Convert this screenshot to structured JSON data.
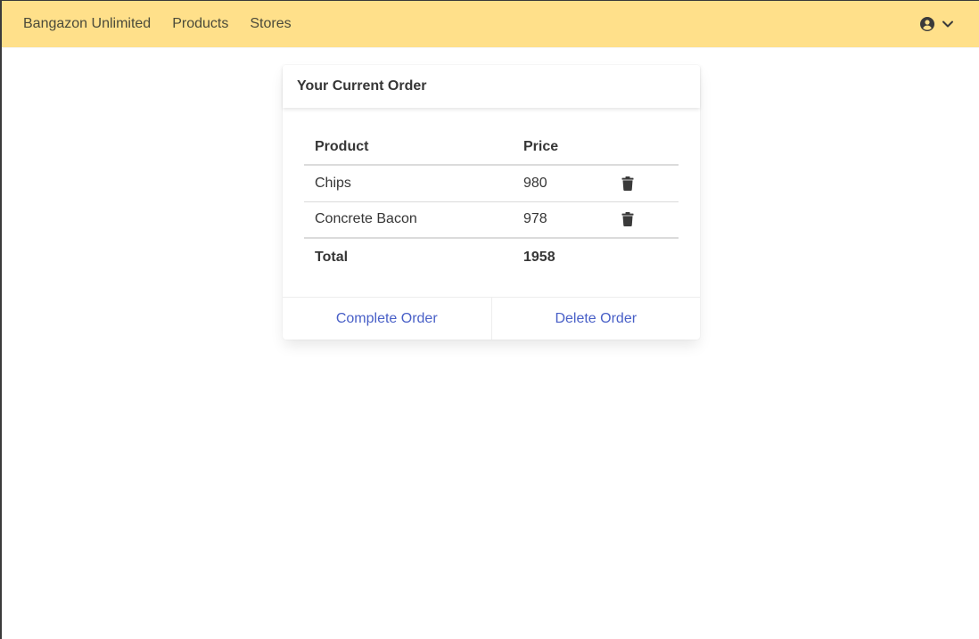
{
  "navbar": {
    "brand": "Bangazon Unlimited",
    "links": [
      "Products",
      "Stores"
    ],
    "user_icon": "user-circle-icon",
    "dropdown_icon": "chevron-down-icon"
  },
  "order": {
    "title": "Your Current Order",
    "columns": {
      "product": "Product",
      "price": "Price"
    },
    "items": [
      {
        "product": "Chips",
        "price": "980"
      },
      {
        "product": "Concrete Bacon",
        "price": "978"
      }
    ],
    "total_label": "Total",
    "total_value": "1958",
    "actions": {
      "complete": "Complete Order",
      "delete": "Delete Order"
    }
  },
  "colors": {
    "navbar_bg": "#ffe08a",
    "link": "#485fc7",
    "text": "#363636"
  }
}
